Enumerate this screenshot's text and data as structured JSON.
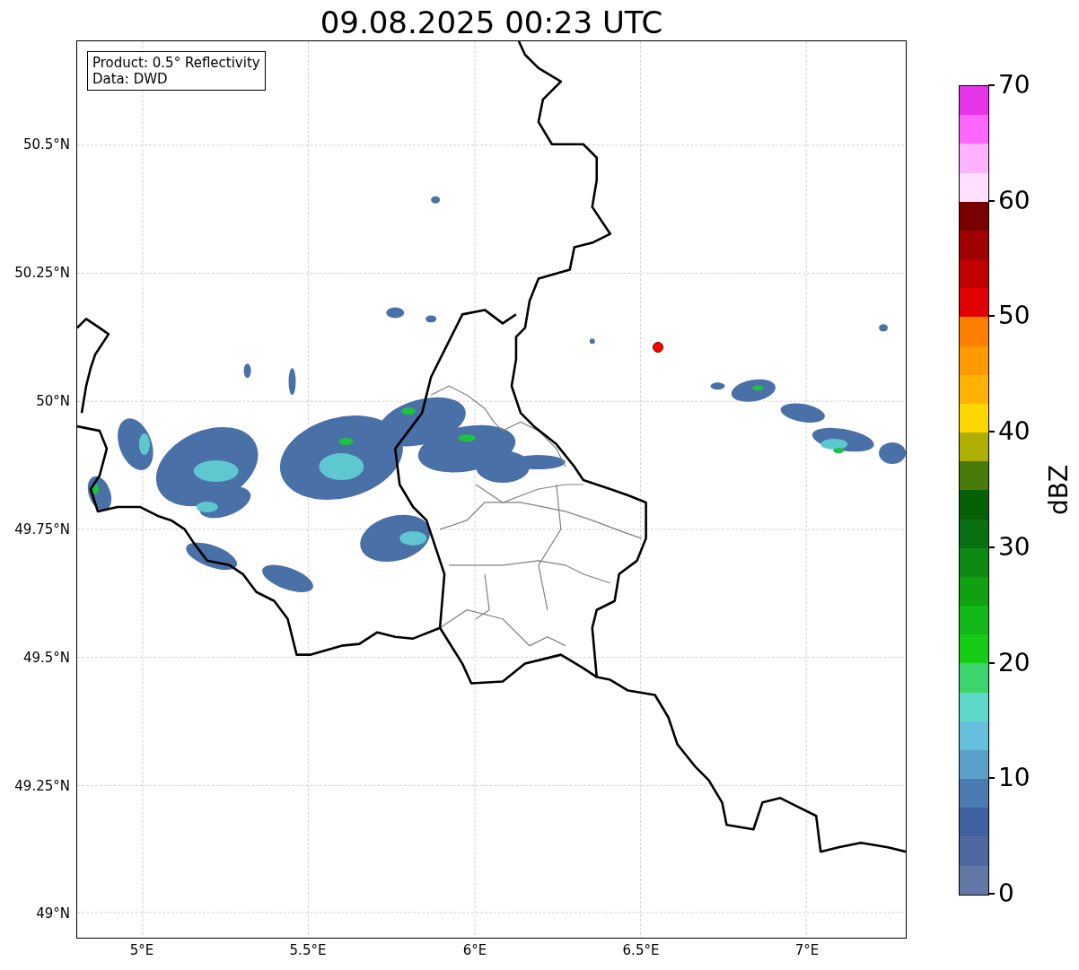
{
  "title": "09.08.2025 00:23 UTC",
  "map": {
    "info_box": [
      "Product: 0.5° Reflectivity",
      "Data: DWD"
    ],
    "y_ticks": [
      "50.5°N",
      "50.25°N",
      "50°N",
      "49.75°N",
      "49.5°N",
      "49.25°N",
      "49°N"
    ],
    "x_ticks": [
      "5°E",
      "5.5°E",
      "6°E",
      "6.5°E",
      "7°E"
    ],
    "station": {
      "color": "#ff0000"
    }
  },
  "colorbar": {
    "label": "dBZ",
    "ticks": [
      "70",
      "60",
      "50",
      "40",
      "30",
      "20",
      "10",
      "0"
    ],
    "bands": [
      {
        "color": "#e935ea"
      },
      {
        "color": "#ff66ff"
      },
      {
        "color": "#ffb3ff"
      },
      {
        "color": "#ffe0ff"
      },
      {
        "color": "#780000"
      },
      {
        "color": "#a00000"
      },
      {
        "color": "#c00000"
      },
      {
        "color": "#e00000"
      },
      {
        "color": "#ff7f00"
      },
      {
        "color": "#ff9900"
      },
      {
        "color": "#ffb300"
      },
      {
        "color": "#ffd700"
      },
      {
        "color": "#afaf00"
      },
      {
        "color": "#4a7a0a"
      },
      {
        "color": "#066006"
      },
      {
        "color": "#0a7014"
      },
      {
        "color": "#0c8a14"
      },
      {
        "color": "#10a010"
      },
      {
        "color": "#12b818"
      },
      {
        "color": "#14cc14"
      },
      {
        "color": "#3cd46c"
      },
      {
        "color": "#60d8c8"
      },
      {
        "color": "#64c0dc"
      },
      {
        "color": "#5aa0c8"
      },
      {
        "color": "#4a7ab0"
      },
      {
        "color": "#4060a0"
      },
      {
        "color": "#5068a0"
      },
      {
        "color": "#6478a8"
      }
    ]
  }
}
